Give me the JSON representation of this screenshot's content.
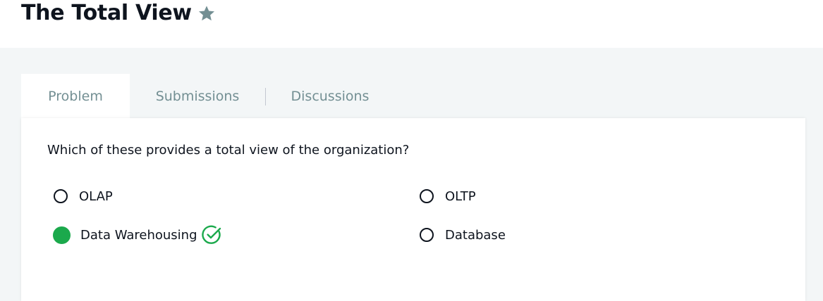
{
  "header": {
    "title": "The Total View"
  },
  "tabs": [
    {
      "label": "Problem",
      "active": true
    },
    {
      "label": "Submissions",
      "active": false
    },
    {
      "label": "Discussions",
      "active": false
    }
  ],
  "problem": {
    "question": "Which of these provides a total view of the organization?",
    "options": [
      {
        "label": "OLAP",
        "selected": false
      },
      {
        "label": "OLTP",
        "selected": false
      },
      {
        "label": "Data Warehousing",
        "selected": true,
        "correct": true
      },
      {
        "label": "Database",
        "selected": false
      }
    ]
  },
  "colors": {
    "accent_green": "#1ba94c",
    "star_gray": "#738f93",
    "text_dark": "#0e141e",
    "tab_gray": "#738f93"
  },
  "icons": {
    "star": "star-icon",
    "correct": "check-circle-icon"
  }
}
